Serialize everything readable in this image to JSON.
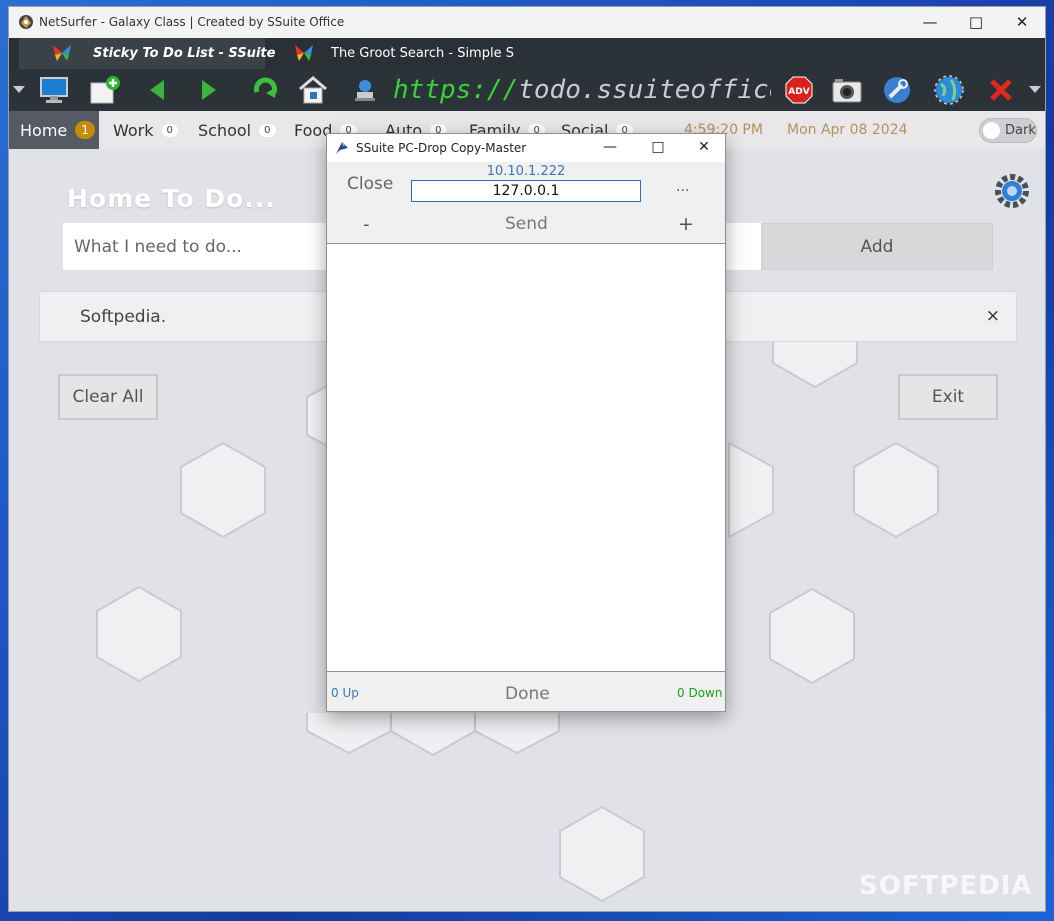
{
  "window": {
    "title": "NetSurfer - Galaxy Class | Created by SSuite Office"
  },
  "tabs": [
    {
      "label": "Sticky To Do List - SSuite"
    },
    {
      "label": "The Groot Search - Simple S"
    }
  ],
  "toolbar": {
    "url_scheme": "https://",
    "url_rest": "todo.ssuiteoffice.com",
    "adv_label": "ADV"
  },
  "categories": [
    {
      "label": "Home",
      "count": "1"
    },
    {
      "label": "Work",
      "count": "0"
    },
    {
      "label": "School",
      "count": "0"
    },
    {
      "label": "Food",
      "count": "0"
    },
    {
      "label": "Auto",
      "count": "0"
    },
    {
      "label": "Family",
      "count": "0"
    },
    {
      "label": "Social",
      "count": "0"
    }
  ],
  "status": {
    "time": "4:59:20 PM",
    "date": "Mon Apr 08 2024",
    "dark_label": "Dark"
  },
  "main": {
    "title": "Home To Do...",
    "input_placeholder": "What I need to do...",
    "add_label": "Add",
    "items": [
      {
        "text": "Softpedia."
      }
    ],
    "delete_glyph": "×",
    "clear_label": "Clear All",
    "exit_label": "Exit"
  },
  "dialog": {
    "title": "SSuite PC-Drop Copy-Master",
    "close_label": "Close",
    "ip_remote": "10.10.1.222",
    "ip_local": "127.0.0.1",
    "more_label": "...",
    "minus_label": "-",
    "send_label": "Send",
    "plus_label": "+",
    "up_label": "0 Up",
    "done_label": "Done",
    "down_label": "0 Down"
  },
  "watermark": "SOFTPEDIA",
  "icons": [
    "app-icon",
    "butterfly-icon",
    "monitor-icon",
    "new-tab-icon",
    "back-icon",
    "forward-icon",
    "refresh-icon",
    "home-icon",
    "stamp-icon",
    "adblock-icon",
    "camera-icon",
    "tools-icon",
    "globe-icon",
    "close-tab-icon",
    "settings-gear-icon"
  ]
}
